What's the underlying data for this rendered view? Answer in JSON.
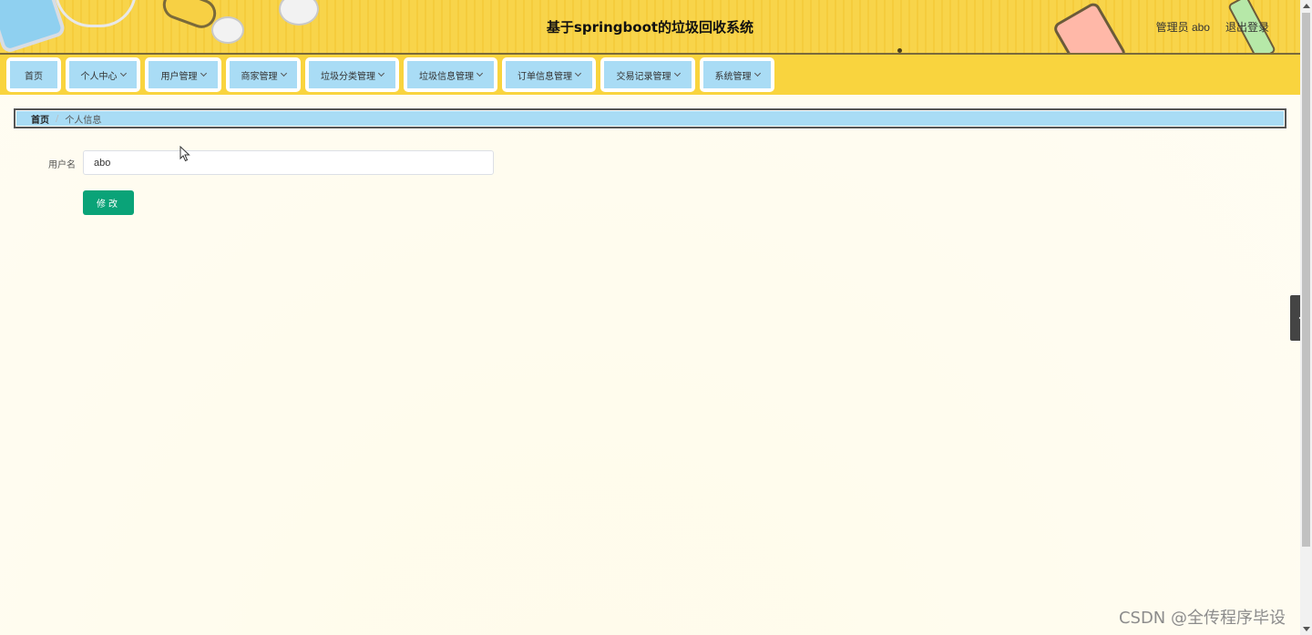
{
  "header": {
    "title": "基于springboot的垃圾回收系统",
    "user_label": "管理员 abo",
    "logout_label": "退出登录"
  },
  "nav": {
    "items": [
      {
        "label": "首页",
        "has_dropdown": false
      },
      {
        "label": "个人中心",
        "has_dropdown": true
      },
      {
        "label": "用户管理",
        "has_dropdown": true
      },
      {
        "label": "商家管理",
        "has_dropdown": true
      },
      {
        "label": "垃圾分类管理",
        "has_dropdown": true
      },
      {
        "label": "垃圾信息管理",
        "has_dropdown": true
      },
      {
        "label": "订单信息管理",
        "has_dropdown": true
      },
      {
        "label": "交易记录管理",
        "has_dropdown": true
      },
      {
        "label": "系统管理",
        "has_dropdown": true
      }
    ]
  },
  "breadcrumb": {
    "home": "首页",
    "separator": "/",
    "current": "个人信息"
  },
  "form": {
    "username_label": "用户名",
    "username_value": "abo",
    "submit_label": "修改"
  },
  "watermark": "CSDN @全传程序毕设",
  "colors": {
    "nav_bg": "#f9d43e",
    "nav_item_bg": "#a9dcf5",
    "button_bg": "#0aa378"
  }
}
